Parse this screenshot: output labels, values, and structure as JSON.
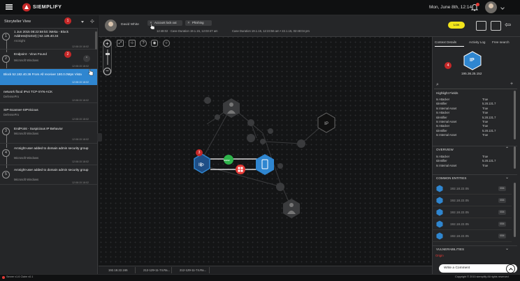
{
  "app": {
    "name": "SIEMPLIFY",
    "datetime": "Mon, June 8th, 12:14"
  },
  "colors": {
    "accent_blue": "#2f86d0",
    "priority_yellow": "#f2e41b",
    "badge_red": "#c62828",
    "attacker_red": "#e53935",
    "allow_green": "#2db34a"
  },
  "left": {
    "view_label": "Storyteller View",
    "view_badge": "1",
    "items": [
      {
        "num": "1",
        "title": "1 Jun 2015 08:22:58 kit: iMeka - Block Address(01010) | 52.128.40.34",
        "sub": "ArcSight",
        "time": "12:08:15 18:02"
      },
      {
        "num": "2",
        "title": "Endpoint - Virus Found",
        "sub": "Microsoft Windows",
        "time": "12:08:15 18:02",
        "badge": "2"
      },
      {
        "num": "",
        "title": "Block 52.182.40.36 From All receiver 180.0.0Mps Vista",
        "sub": "",
        "time": "12:08:15 18:02"
      },
      {
        "num": "",
        "title": "network flood IPv4 TCP-SYN-ACK",
        "sub": "DefensePro",
        "time": "12:08:15 18:02"
      },
      {
        "num": "",
        "title": "SIP-Scanner-SIPVicious",
        "sub": "DefensePro",
        "time": "12:08:15 18:02"
      },
      {
        "num": "3",
        "title": "EndPoint - Suspicious IP Behavior",
        "sub": "Microsoft Windows",
        "time": "12:08:15 18:02"
      },
      {
        "num": "4",
        "title": "Arcsight-user added to domain admin security group",
        "sub": "Microsoft Windows",
        "time": "12:08:15 18:02"
      },
      {
        "num": "5",
        "title": "Arcsight-user added to domain admin security group",
        "sub": "Microsoft Windows",
        "time": "12:08:15 18:02"
      }
    ]
  },
  "case": {
    "user": "David White",
    "tags": [
      "Account lock out",
      "Phishing"
    ],
    "meta1": "12:48:02 ·  Case Duration 19.1.15, 12:03:47 am",
    "meta2": "Case Duration 19.1.15, 12:23:56 am • 22.1.15, 02:48:04 pm",
    "priority": "Low"
  },
  "graph": {
    "badge": "3",
    "node_center": "IP",
    "label_www": "www",
    "tabs": [
      "192.18.22.165",
      "212-129-11-74.Ra...",
      "212-129-11-74.Ra..."
    ]
  },
  "right": {
    "tabs": [
      "Context Details",
      "Activity Log",
      "Free search"
    ],
    "badge": "4",
    "entity_type": "IP",
    "entity_ip": "195.36.25.152",
    "highlight_title": "Highlight Fields",
    "highlight": [
      [
        "Is Attacker",
        "True"
      ],
      [
        "Identifier",
        "5.28.131.7"
      ],
      [
        "Is Internal Asset",
        "True"
      ],
      [
        "Is Attacker",
        "True"
      ],
      [
        "Identifier",
        "5.28.131.7"
      ],
      [
        "Is Internal Asset",
        "True"
      ],
      [
        "Is Attacker",
        "True"
      ],
      [
        "Identifier",
        "5.28.131.7"
      ],
      [
        "Is Internal Asset",
        "True"
      ]
    ],
    "overview_title": "OVERVIEW",
    "overview": [
      [
        "Is Attacker",
        "True"
      ],
      [
        "Identifier",
        "5.28.131.7"
      ],
      [
        "Is Internal Asset",
        "True"
      ]
    ],
    "common_title": "COMMON ENTITIES",
    "common": [
      {
        "ip": "192.18.22.05",
        "count": "654"
      },
      {
        "ip": "192.18.22.05",
        "count": "654"
      },
      {
        "ip": "192.18.22.05",
        "count": "654"
      },
      {
        "ip": "192.18.22.05",
        "count": "654"
      },
      {
        "ip": "192.18.22.05",
        "count": "654"
      }
    ],
    "vuln_title": "VULNERABILITIES",
    "vuln_item": "Origin",
    "comment": "Write a Comment"
  },
  "footer": {
    "left": "Server v1.6   Claim v0.1",
    "right": "Copyright © 2015 siemplify All rights reserved"
  }
}
